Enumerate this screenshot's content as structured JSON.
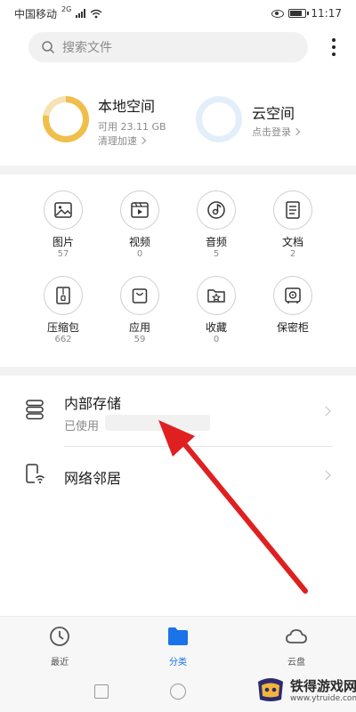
{
  "status_bar": {
    "carrier": "中国移动",
    "network": "2G",
    "time": "11:17"
  },
  "search": {
    "placeholder": "搜索文件"
  },
  "storage": {
    "local": {
      "title": "本地空间",
      "available": "可用 23.11 GB",
      "action": "清理加速",
      "used_fraction": 0.78
    },
    "cloud": {
      "title": "云空间",
      "action": "点击登录"
    }
  },
  "categories": [
    {
      "name": "图片",
      "count": "57",
      "icon": "image-icon"
    },
    {
      "name": "视频",
      "count": "0",
      "icon": "video-icon"
    },
    {
      "name": "音频",
      "count": "5",
      "icon": "audio-icon"
    },
    {
      "name": "文档",
      "count": "2",
      "icon": "document-icon"
    },
    {
      "name": "压缩包",
      "count": "662",
      "icon": "archive-icon"
    },
    {
      "name": "应用",
      "count": "59",
      "icon": "app-bag-icon"
    },
    {
      "name": "收藏",
      "count": "0",
      "icon": "favorite-folder-icon"
    },
    {
      "name": "保密柜",
      "count": "",
      "icon": "safe-icon"
    }
  ],
  "list": {
    "internal_storage": {
      "title": "内部存储",
      "subtitle": "已使用"
    },
    "network_neighbor": {
      "title": "网络邻居"
    }
  },
  "bottom_nav": [
    {
      "label": "最近",
      "icon": "clock-icon",
      "active": false
    },
    {
      "label": "分类",
      "icon": "folder-icon",
      "active": true
    },
    {
      "label": "云盘",
      "icon": "cloud-icon",
      "active": false
    }
  ],
  "colors": {
    "accent": "#1a73e8",
    "ring_local": "#f0be4a",
    "ring_cloud": "#e3eefb",
    "arrow": "#e02020"
  },
  "watermark": {
    "name": "铁得游戏网",
    "url": "www.ytruide.com"
  }
}
